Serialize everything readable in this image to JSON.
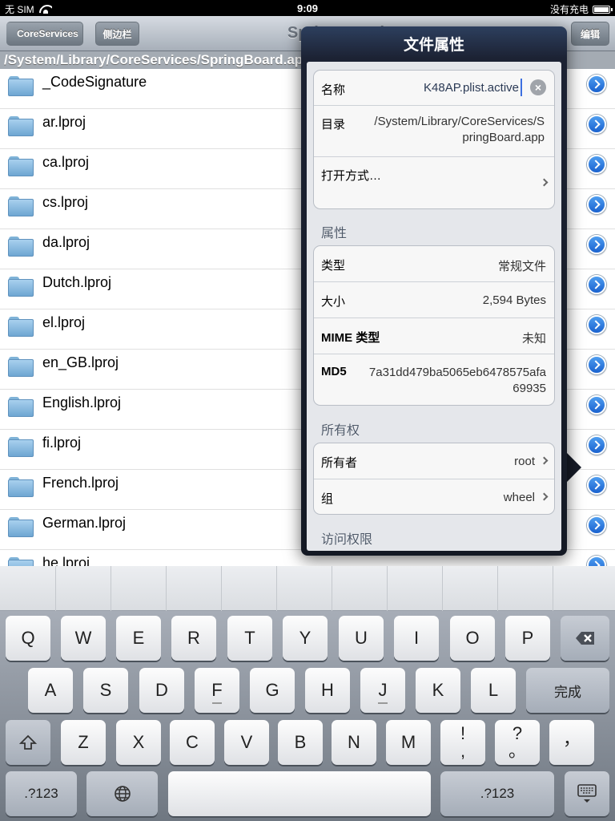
{
  "status_bar": {
    "carrier": "无 SIM",
    "time": "9:09",
    "charging": "没有充电"
  },
  "nav_bar": {
    "back_label": "CoreServices",
    "sidebar_label": "侧边栏",
    "title": "SpringBoard.app",
    "edit_label": "编辑"
  },
  "path_bar": {
    "path": "/System/Library/CoreServices/SpringBoard.app"
  },
  "files": [
    {
      "name": "_CodeSignature"
    },
    {
      "name": "ar.lproj"
    },
    {
      "name": "ca.lproj"
    },
    {
      "name": "cs.lproj"
    },
    {
      "name": "da.lproj"
    },
    {
      "name": "Dutch.lproj"
    },
    {
      "name": "el.lproj"
    },
    {
      "name": "en_GB.lproj"
    },
    {
      "name": "English.lproj"
    },
    {
      "name": "fi.lproj"
    },
    {
      "name": "French.lproj"
    },
    {
      "name": "German.lproj"
    },
    {
      "name": "he.lproj"
    }
  ],
  "popover": {
    "title": "文件属性",
    "name_label": "名称",
    "name_value": "K48AP.plist.active",
    "dir_label": "目录",
    "dir_value_line1": "/System/Library/CoreServices/S",
    "dir_value_line2": "pringBoard.app",
    "open_with_label": "打开方式…",
    "attributes_header": "属性",
    "type_label": "类型",
    "type_value": "常规文件",
    "size_label": "大小",
    "size_value": "2,594 Bytes",
    "mime_label": "MIME 类型",
    "mime_value": "未知",
    "md5_label": "MD5",
    "md5_value_line1": "7a31dd479ba5065eb6478575afa",
    "md5_value_line2": "69935",
    "ownership_header": "所有权",
    "owner_label": "所有者",
    "owner_value": "root",
    "group_label": "组",
    "group_value": "wheel",
    "permissions_header": "访问权限"
  },
  "keyboard": {
    "row1": [
      "Q",
      "W",
      "E",
      "R",
      "T",
      "Y",
      "U",
      "I",
      "O",
      "P"
    ],
    "row2": [
      "A",
      "S",
      "D",
      "F",
      "G",
      "H",
      "J",
      "K",
      "L"
    ],
    "done_label": "完成",
    "row3": [
      "Z",
      "X",
      "C",
      "V",
      "B",
      "N",
      "M"
    ],
    "punct1_top": "!",
    "punct1_bottom": ",",
    "punct2_top": "?",
    "punct2_bottom": "。",
    "punct3": "，",
    "numbers_label": ".?123"
  }
}
